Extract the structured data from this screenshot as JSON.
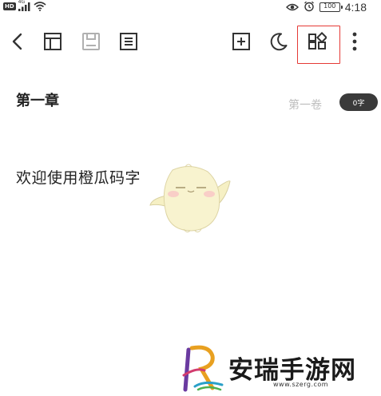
{
  "status_bar": {
    "hd_badge": "HD",
    "network_label": "4G",
    "battery_level": "100",
    "time": "4:18"
  },
  "toolbar": {
    "icons": [
      "back-icon",
      "table-icon",
      "save-icon",
      "outline-icon",
      "add-chapter-icon",
      "night-mode-icon",
      "more-features-icon",
      "overflow-menu-icon"
    ],
    "highlight_color": "#e53935"
  },
  "editor": {
    "chapter_title": "第一章",
    "volume": "第一卷",
    "word_count": "0字",
    "body_text": "欢迎使用橙瓜码字"
  },
  "watermark": {
    "title": "安瑞手游网",
    "url": "www.szerg.com"
  }
}
